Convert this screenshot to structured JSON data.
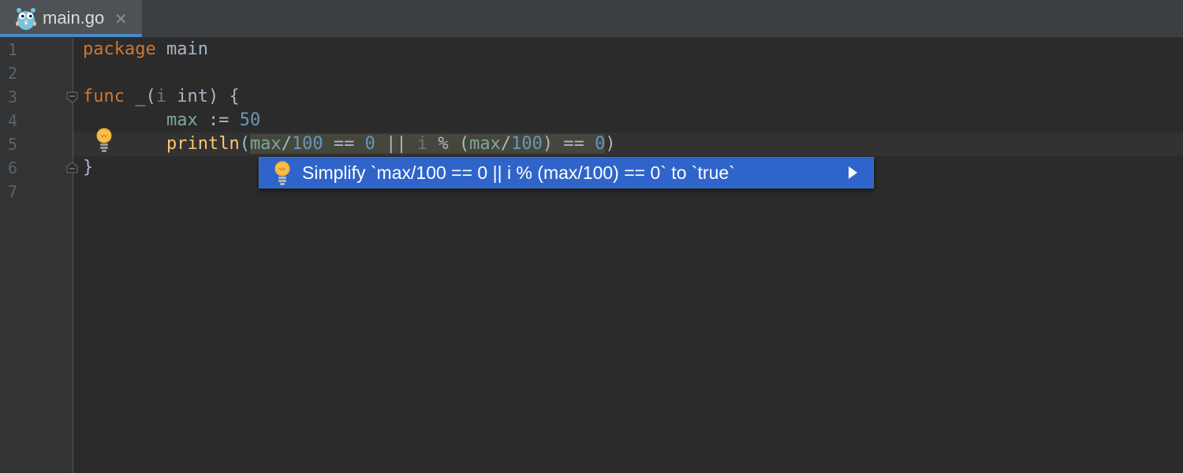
{
  "tab": {
    "label": "main.go",
    "close_glyph": "✕",
    "icon": "gopher-icon"
  },
  "gutter": {
    "line_numbers": [
      "1",
      "2",
      "3",
      "4",
      "5",
      "6",
      "7"
    ]
  },
  "code": {
    "line1": {
      "kw": "package",
      "rest": " main"
    },
    "line3": {
      "kw": "func",
      "name": " _(",
      "param": "i",
      "type": " int",
      "brace": ") {"
    },
    "line4": {
      "indent": "        ",
      "var": "max",
      "op": " := ",
      "num": "50"
    },
    "line5": {
      "indent": "        ",
      "fn": "println",
      "open": "(",
      "t1": "max",
      "t2": "/",
      "t3": "100",
      "t4": " == ",
      "t5": "0",
      "t6": " || ",
      "t7": "i",
      "t8": " % (",
      "t9": "max",
      "t10": "/",
      "t11": "100",
      "t12": ") == ",
      "t13": "0",
      "close": ")"
    },
    "line6": {
      "brace": "}"
    }
  },
  "intention": {
    "label": "Simplify `max/100 == 0 || i % (max/100) == 0` to `true`",
    "icon": "lightbulb-icon",
    "submenu_icon": "chevron-right-icon"
  },
  "colors": {
    "keyword": "#cc7832",
    "function": "#ffc66d",
    "number": "#6897bb",
    "popup_bg": "#2f65ca"
  }
}
